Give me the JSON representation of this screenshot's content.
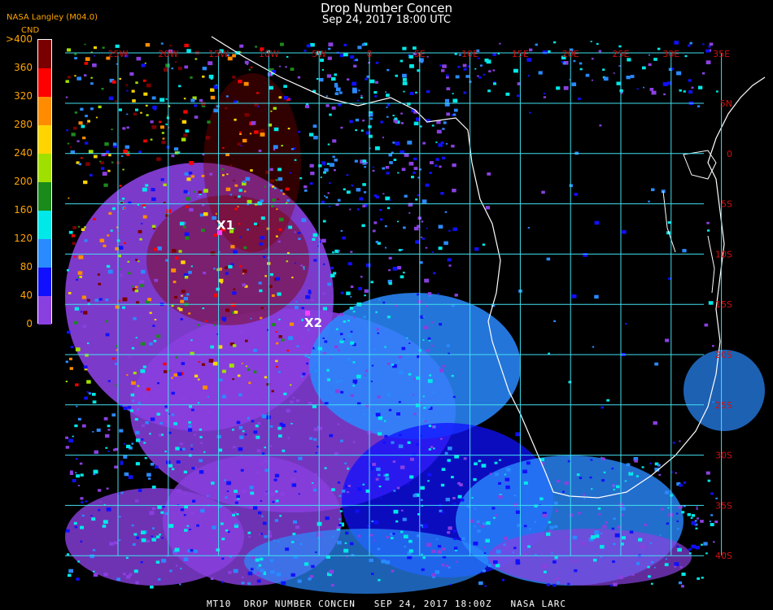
{
  "header": {
    "title": "Drop Number Concen",
    "subtitle": "Sep 24, 2017 18:00 UTC",
    "agency": "NASA Langley (M04.0)",
    "parameter": "CND"
  },
  "legend": {
    "labels": [
      ">400",
      "360",
      "320",
      "280",
      "240",
      "200",
      "160",
      "120",
      "80",
      "40",
      "0"
    ],
    "colors": [
      "#7a0000",
      "#ff0000",
      "#ff8c00",
      "#ffd400",
      "#a0e000",
      "#1a8a1a",
      "#00e8e8",
      "#2a8aff",
      "#1010ff",
      "#8a40e0"
    ]
  },
  "grid": {
    "longitude_labels": [
      "25W",
      "20W",
      "15W",
      "10W",
      "5W",
      "0",
      "5E",
      "10E",
      "15E",
      "20E",
      "25E",
      "30E",
      "35E"
    ],
    "latitude_labels": [
      "5N",
      "0",
      "5S",
      "10S",
      "15S",
      "20S",
      "25S",
      "30S",
      "35S",
      "40S"
    ],
    "line_color": "#40e0f0",
    "label_color": "#d01010"
  },
  "markers": [
    {
      "label": "X1",
      "color": "#ff40ff"
    },
    {
      "label": "X2",
      "color": "#ff40ff"
    }
  ],
  "footer": "MT10  DROP NUMBER CONCEN   SEP 24, 2017 18:00Z   NASA LARC"
}
